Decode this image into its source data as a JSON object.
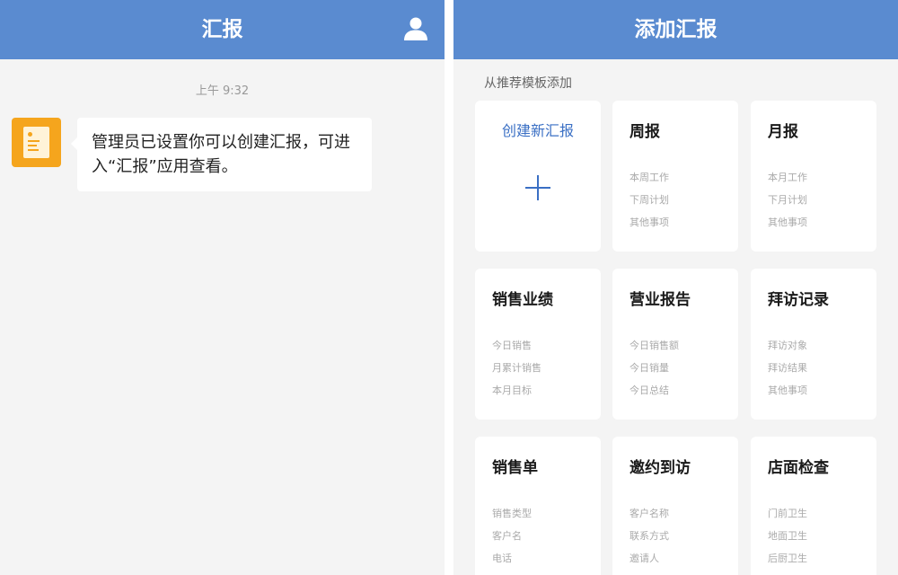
{
  "left_screen": {
    "nav_title": "汇报",
    "timestamp": "上午 9:32",
    "message": {
      "app_icon": "report-app-icon",
      "text": "管理员已设置你可以创建汇报，可进入“汇报”应用查看。"
    },
    "header_icon": "user-icon"
  },
  "right_screen": {
    "nav_title": "添加汇报",
    "section_label": "从推荐模板添加",
    "create_card": {
      "label": "创建新汇报",
      "icon": "plus-icon"
    },
    "templates": [
      {
        "title": "周报",
        "items": [
          "本周工作",
          "下周计划",
          "其他事项"
        ]
      },
      {
        "title": "月报",
        "items": [
          "本月工作",
          "下月计划",
          "其他事项"
        ]
      },
      {
        "title": "销售业绩",
        "items": [
          "今日销售",
          "月累计销售",
          "本月目标"
        ]
      },
      {
        "title": "营业报告",
        "items": [
          "今日销售额",
          "今日销量",
          "今日总结"
        ]
      },
      {
        "title": "拜访记录",
        "items": [
          "拜访对象",
          "拜访结果",
          "其他事项"
        ]
      },
      {
        "title": "销售单",
        "items": [
          "销售类型",
          "客户名",
          "电话"
        ]
      },
      {
        "title": "邀约到访",
        "items": [
          "客户名称",
          "联系方式",
          "邀请人"
        ]
      },
      {
        "title": "店面检查",
        "items": [
          "门前卫生",
          "地面卫生",
          "后厨卫生"
        ]
      }
    ]
  },
  "colors": {
    "nav_bar": "#5a8bd0",
    "accent": "#3a6fc4",
    "app_icon": "#f5a51d",
    "background": "#f4f4f4"
  }
}
